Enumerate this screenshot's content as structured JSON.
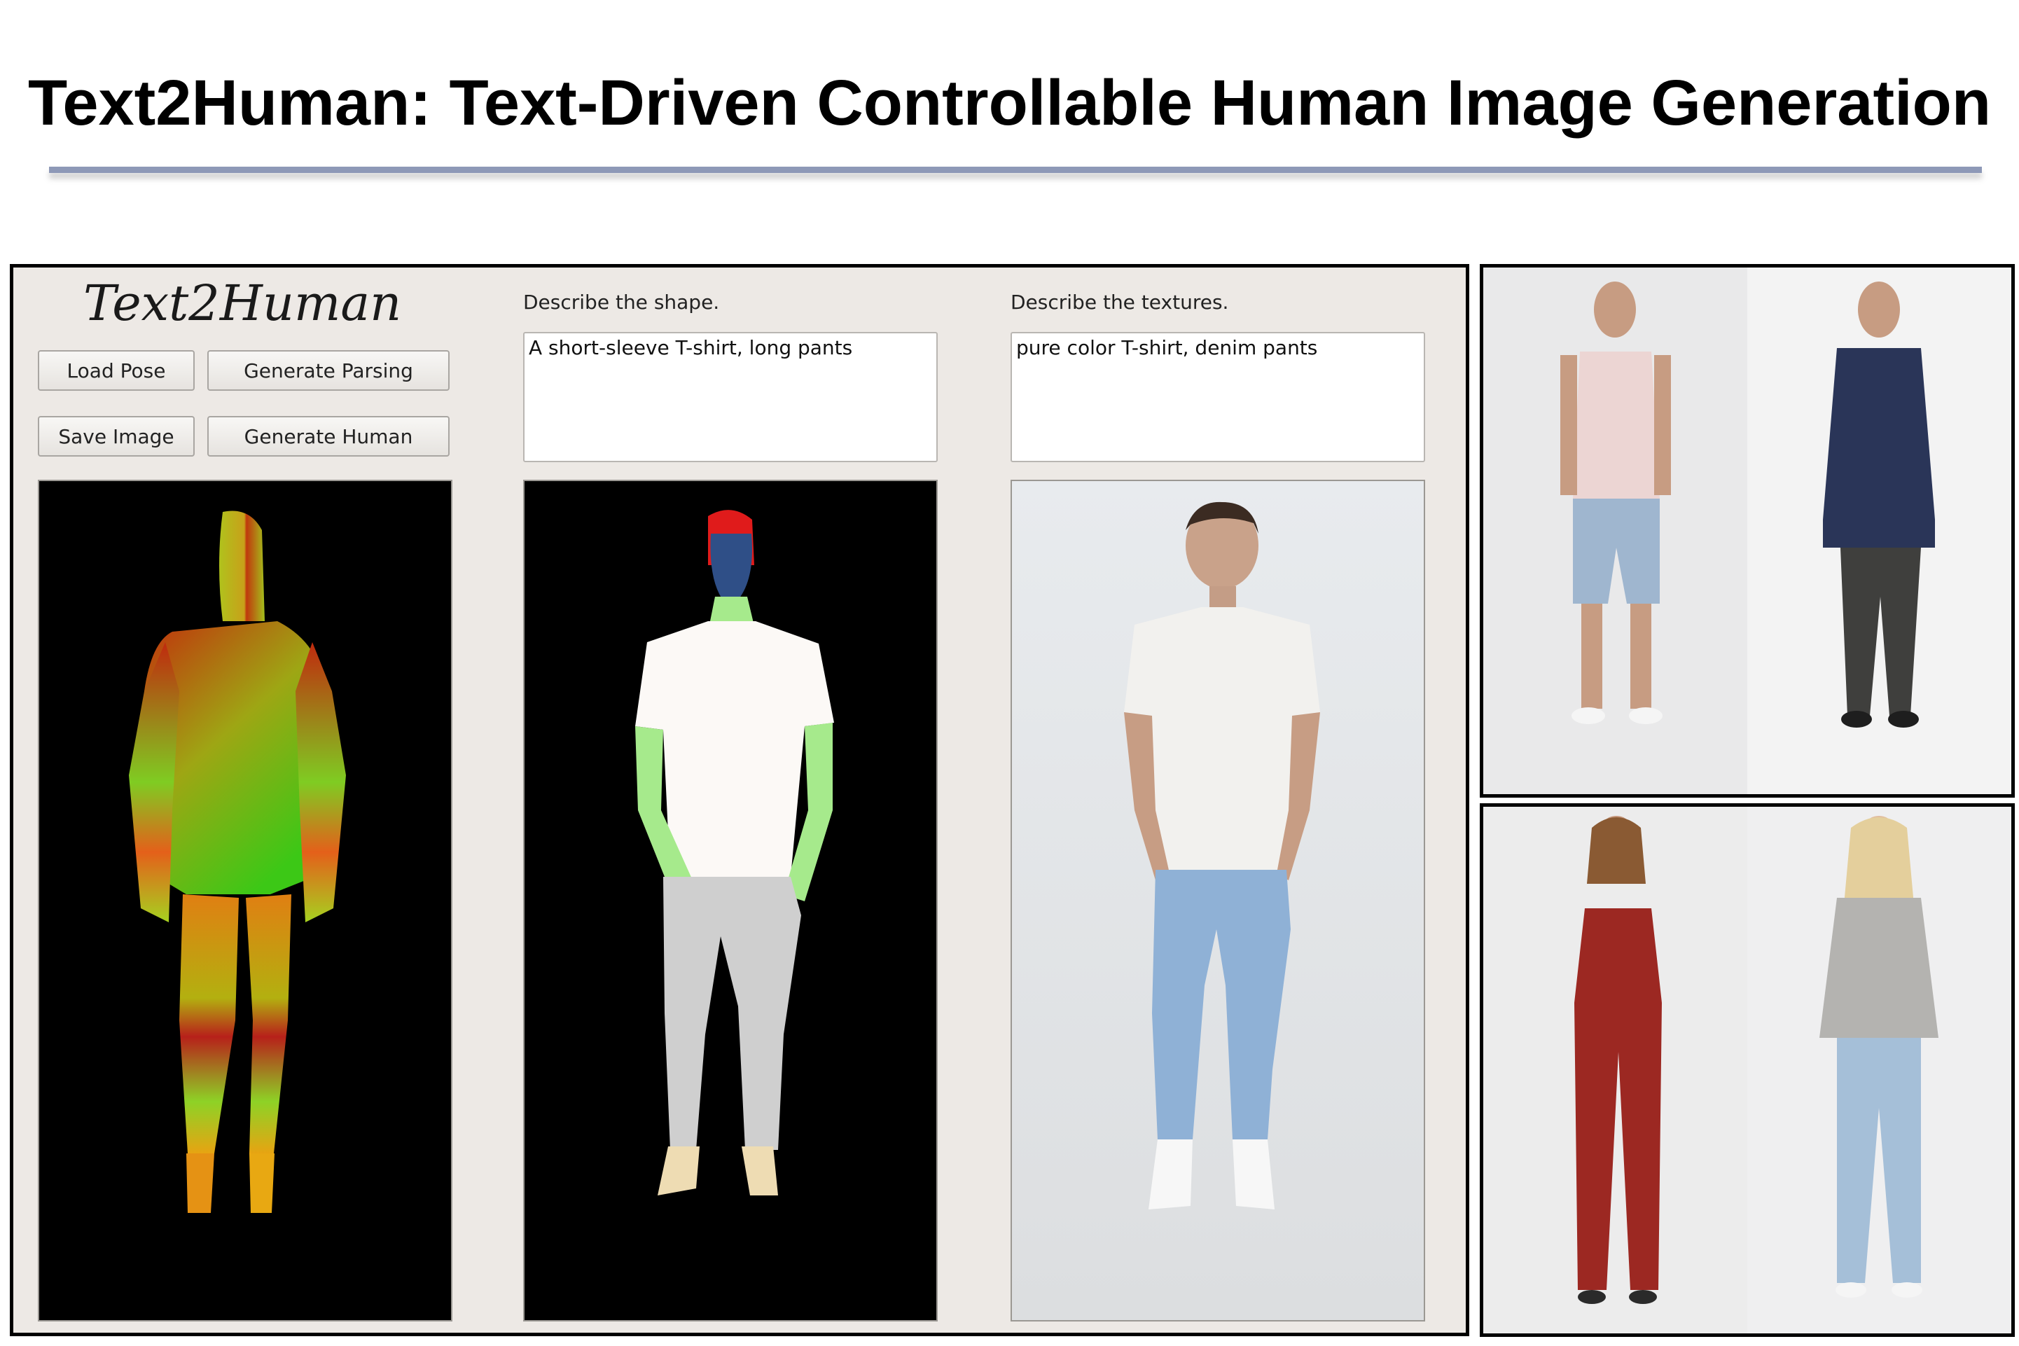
{
  "page": {
    "title": "Text2Human: Text-Driven Controllable Human Image Generation"
  },
  "app": {
    "logo": "Text2Human",
    "buttons": {
      "load_pose": "Load Pose",
      "generate_parsing": "Generate Parsing",
      "save_image": "Save Image",
      "generate_human": "Generate Human"
    },
    "shape": {
      "label": "Describe the shape.",
      "value": "A short-sleeve T-shirt, long pants"
    },
    "texture": {
      "label": "Describe the textures.",
      "value": "pure color T-shirt, denim pants"
    }
  },
  "colors": {
    "title_rule": "#8e99b7",
    "app_background": "#ede9e5",
    "parsing_hair": "#e01b1b",
    "parsing_face": "#2f4f87",
    "parsing_skin": "#a6ea8c",
    "parsing_top": "#fcf9f6",
    "parsing_pants": "#cfcfcf",
    "parsing_shoes": "#eedcb3"
  }
}
